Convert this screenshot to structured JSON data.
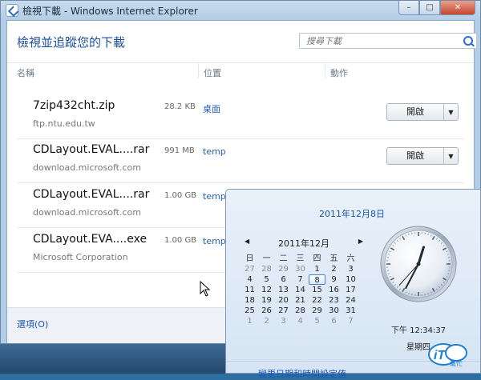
{
  "window": {
    "title": "檢視下載 - Windows Internet Explorer",
    "controls": {
      "minimize": "–",
      "maximize": "□",
      "close": "✕"
    }
  },
  "heading": "檢視並追蹤您的下載",
  "search": {
    "placeholder": "搜尋下載"
  },
  "columns": {
    "name": "名稱",
    "location": "位置",
    "action": "動作"
  },
  "downloads": [
    {
      "name": "7zip432cht.zip",
      "source": "ftp.ntu.edu.tw",
      "size": "28.2 KB",
      "location": "桌面",
      "action": "開啟"
    },
    {
      "name": "CDLayout.EVAL....rar",
      "source": "download.microsoft.com",
      "size": "991 MB",
      "location": "temp",
      "action": "開啟"
    },
    {
      "name": "CDLayout.EVAL....rar",
      "source": "download.microsoft.com",
      "size": "1.00 GB",
      "location": "temp"
    },
    {
      "name": "CDLayout.EVA....exe",
      "source": "Microsoft Corporation",
      "size": "1.00 GB",
      "location": "temp"
    }
  ],
  "footer": {
    "options": "選項(O)"
  },
  "calendar": {
    "long_date": "2011年12月8日",
    "month_title": "2011年12月",
    "prev": "◀",
    "next": "▶",
    "weekdays": [
      "日",
      "一",
      "二",
      "三",
      "四",
      "五",
      "六"
    ],
    "days": [
      "27",
      "28",
      "29",
      "30",
      "1",
      "2",
      "3",
      "4",
      "5",
      "6",
      "7",
      "8",
      "9",
      "10",
      "11",
      "12",
      "13",
      "14",
      "15",
      "16",
      "17",
      "18",
      "19",
      "20",
      "21",
      "22",
      "23",
      "24",
      "25",
      "26",
      "27",
      "28",
      "29",
      "30",
      "31",
      "1",
      "2",
      "3",
      "4",
      "5",
      "6",
      "7"
    ],
    "other_month_indices": [
      0,
      1,
      2,
      3,
      35,
      36,
      37,
      38,
      39,
      40,
      41
    ],
    "today_index": 11,
    "time": "下午 12:34:37",
    "weekday_name": "星期四",
    "clock": {
      "hour": 12,
      "minute": 34,
      "second": 37
    },
    "settings_link": "變更日期和時間設定值"
  },
  "logo": {
    "text": "iT",
    "subtext": "幫忙",
    "accent": "#1f7fd1"
  }
}
